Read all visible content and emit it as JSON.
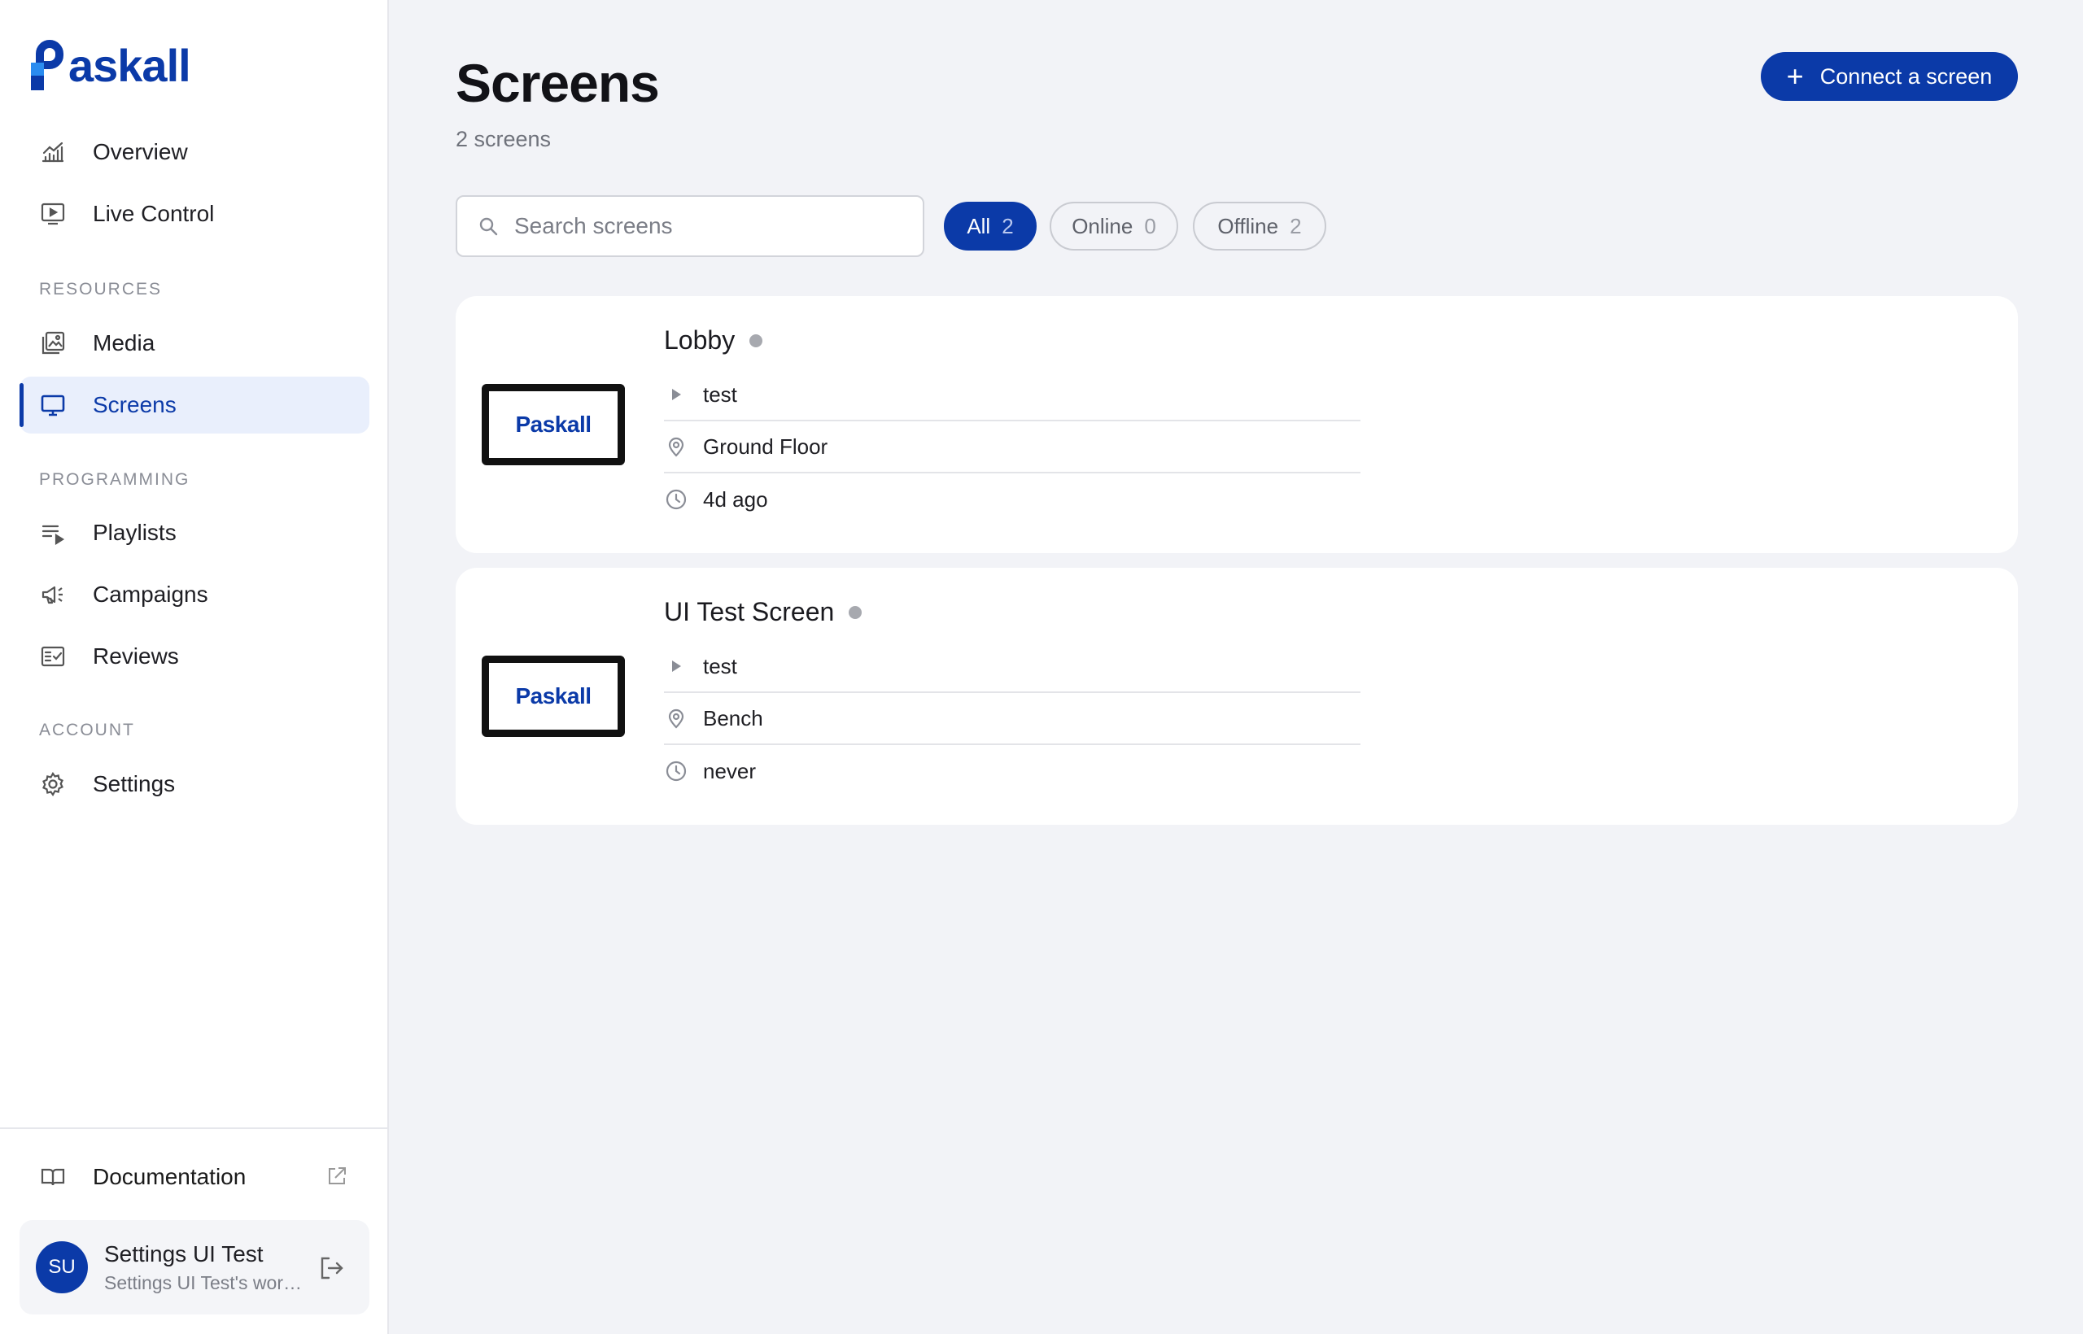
{
  "brand": {
    "name": "askall"
  },
  "sidebar": {
    "nav_top": [
      {
        "label": "Overview",
        "icon": "chart-icon"
      },
      {
        "label": "Live Control",
        "icon": "play-screen-icon"
      }
    ],
    "sections": [
      {
        "label": "RESOURCES",
        "items": [
          {
            "label": "Media",
            "icon": "media-icon"
          },
          {
            "label": "Screens",
            "icon": "monitor-icon",
            "active": true
          }
        ]
      },
      {
        "label": "PROGRAMMING",
        "items": [
          {
            "label": "Playlists",
            "icon": "playlist-icon"
          },
          {
            "label": "Campaigns",
            "icon": "megaphone-icon"
          },
          {
            "label": "Reviews",
            "icon": "checklist-icon"
          }
        ]
      },
      {
        "label": "ACCOUNT",
        "items": [
          {
            "label": "Settings",
            "icon": "gear-icon"
          }
        ]
      }
    ],
    "documentation": {
      "label": "Documentation"
    },
    "user": {
      "initials": "SU",
      "name": "Settings UI Test",
      "sub": "Settings UI Test's workspace"
    }
  },
  "main": {
    "title": "Screens",
    "subtitle": "2 screens",
    "connect_button": "Connect a screen",
    "search_placeholder": "Search screens",
    "filters": [
      {
        "label": "All",
        "count": "2",
        "active": true
      },
      {
        "label": "Online",
        "count": "0"
      },
      {
        "label": "Offline",
        "count": "2"
      }
    ],
    "screens": [
      {
        "name": "Lobby",
        "thumb_logo": "Paskall",
        "playlist": "test",
        "location": "Ground Floor",
        "last_seen": "4d ago",
        "status_color": "#a7a9af"
      },
      {
        "name": "UI Test Screen",
        "thumb_logo": "Paskall",
        "playlist": "test",
        "location": "Bench",
        "last_seen": "never",
        "status_color": "#a7a9af"
      }
    ]
  },
  "colors": {
    "accent": "#0b3aa8",
    "background": "#f2f3f7"
  }
}
